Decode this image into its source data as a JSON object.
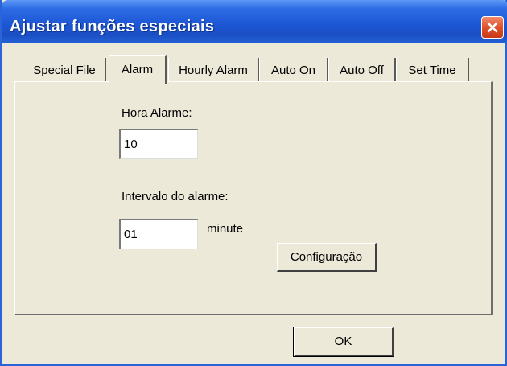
{
  "window": {
    "title": "Ajustar funções especiais",
    "close_icon": "close-icon"
  },
  "tabs": [
    {
      "label": "Special File",
      "active": false
    },
    {
      "label": "Alarm",
      "active": true
    },
    {
      "label": "Hourly Alarm",
      "active": false
    },
    {
      "label": "Auto On",
      "active": false
    },
    {
      "label": "Auto Off",
      "active": false
    },
    {
      "label": "Set Time",
      "active": false
    }
  ],
  "alarm": {
    "hour_label": "Hora Alarme:",
    "hour_value": "10",
    "interval_label": "Intervalo do alarme:",
    "interval_value": "01",
    "interval_unit": "minute",
    "config_button": "Configuração"
  },
  "footer": {
    "ok_button": "OK"
  },
  "colors": {
    "titlebar": "#1d57d5",
    "close": "#e0502a",
    "face": "#ece9d8"
  }
}
